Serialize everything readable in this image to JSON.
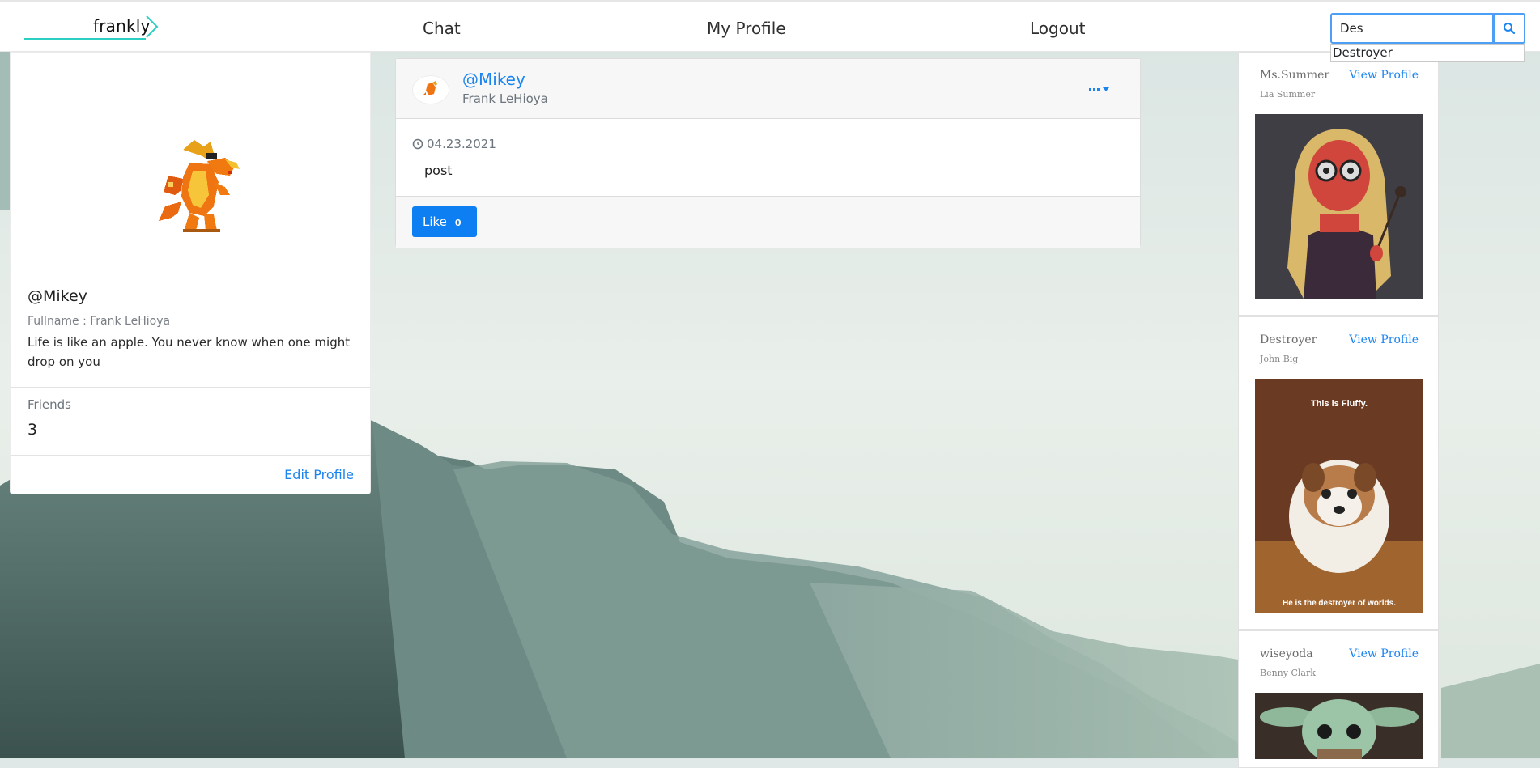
{
  "navbar": {
    "brand": "frankly",
    "links": {
      "chat": "Chat",
      "profile": "My Profile",
      "logout": "Logout"
    },
    "search": {
      "value": "Des",
      "suggestion": "Destroyer"
    }
  },
  "profile": {
    "handle": "@Mikey",
    "fullname": "Fullname : Frank LeHioya",
    "bio": "Life is like an apple. You never know when one might drop on you",
    "friends_label": "Friends",
    "friends_count": "3",
    "edit_label": "Edit Profile"
  },
  "post": {
    "handle": "@Mikey",
    "name": "Frank LeHioya",
    "date": "04.23.2021",
    "body": "post",
    "like_label": "Like",
    "like_count": "0"
  },
  "users": [
    {
      "username": "Ms.Summer",
      "fullname": "Lia Summer",
      "view_label": "View Profile"
    },
    {
      "username": "Destroyer",
      "fullname": "John Big",
      "view_label": "View Profile",
      "image_caption_top": "This is Fluffy.",
      "image_caption_bottom": "He is the destroyer of worlds."
    },
    {
      "username": "wiseyoda",
      "fullname": "Benny Clark",
      "view_label": "View Profile"
    }
  ],
  "colors": {
    "accent": "#1a84f0",
    "brand_line": "#2bd0c2",
    "like_button": "#0d7ff2"
  }
}
